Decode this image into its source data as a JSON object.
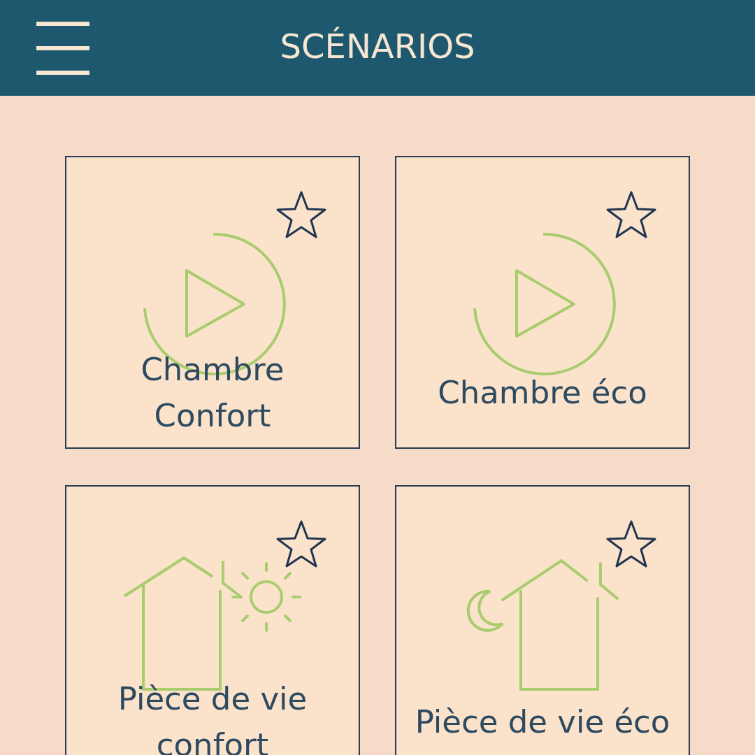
{
  "header": {
    "title": "SCÉNARIOS"
  },
  "scenarios": [
    {
      "name": "Chambre Confort",
      "kind": "play",
      "favorite": false
    },
    {
      "name": "Chambre éco",
      "kind": "play",
      "favorite": false
    },
    {
      "name": "Pièce de vie confort",
      "kind": "house-sun",
      "favorite": false
    },
    {
      "name": "Pièce de vie éco",
      "kind": "house-moon",
      "favorite": false
    }
  ]
}
